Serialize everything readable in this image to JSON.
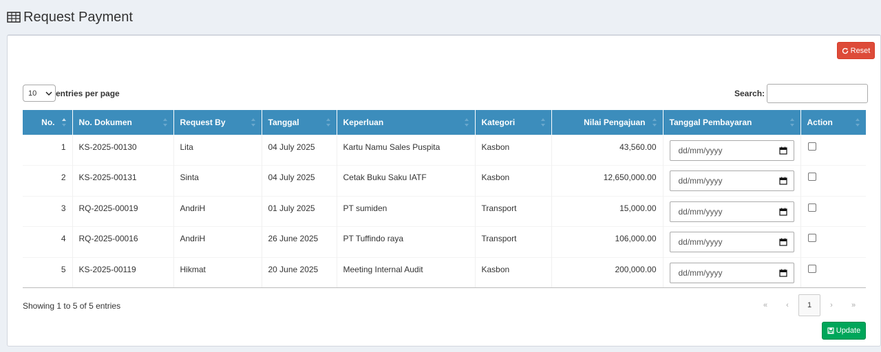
{
  "page": {
    "title": "Request Payment"
  },
  "toolbar": {
    "reset_label": "Reset",
    "update_label": "Update"
  },
  "length": {
    "value": "10",
    "suffix": "entries per page"
  },
  "search": {
    "label": "Search:",
    "value": ""
  },
  "table": {
    "columns": [
      "No.",
      "No. Dokumen",
      "Request By",
      "Tanggal",
      "Keperluan",
      "Kategori",
      "Nilai Pengajuan",
      "Tanggal Pembayaran",
      "Action"
    ],
    "rows": [
      {
        "no": "1",
        "dokumen": "KS-2025-00130",
        "request_by": "Lita",
        "tanggal": "04 July 2025",
        "keperluan": "Kartu Namu Sales Puspita",
        "kategori": "Kasbon",
        "nilai": "43,560.00",
        "tgl_bayar": "dd/mm/yyyy"
      },
      {
        "no": "2",
        "dokumen": "KS-2025-00131",
        "request_by": "Sinta",
        "tanggal": "04 July 2025",
        "keperluan": "Cetak Buku Saku IATF",
        "kategori": "Kasbon",
        "nilai": "12,650,000.00",
        "tgl_bayar": "dd/mm/yyyy"
      },
      {
        "no": "3",
        "dokumen": "RQ-2025-00019",
        "request_by": "AndriH",
        "tanggal": "01 July 2025",
        "keperluan": "PT sumiden",
        "kategori": "Transport",
        "nilai": "15,000.00",
        "tgl_bayar": "dd/mm/yyyy"
      },
      {
        "no": "4",
        "dokumen": "RQ-2025-00016",
        "request_by": "AndriH",
        "tanggal": "26 June 2025",
        "keperluan": "PT Tuffindo raya",
        "kategori": "Transport",
        "nilai": "106,000.00",
        "tgl_bayar": "dd/mm/yyyy"
      },
      {
        "no": "5",
        "dokumen": "KS-2025-00119",
        "request_by": "Hikmat",
        "tanggal": "20 June 2025",
        "keperluan": "Meeting Internal Audit",
        "kategori": "Kasbon",
        "nilai": "200,000.00",
        "tgl_bayar": "dd/mm/yyyy"
      }
    ]
  },
  "footer": {
    "info": "Showing 1 to 5 of 5 entries",
    "pagination": {
      "first": "«",
      "prev": "‹",
      "current": "1",
      "next": "›",
      "last": "»"
    }
  },
  "colors": {
    "header_bg": "#3c8dbc",
    "reset": "#dd4b39",
    "update": "#00a65a",
    "background": "#ecf0f5"
  },
  "icons": {
    "title": "table-icon",
    "reset": "refresh-icon",
    "update": "save-icon",
    "date": "calendar-icon",
    "sort": "sort-icon"
  }
}
